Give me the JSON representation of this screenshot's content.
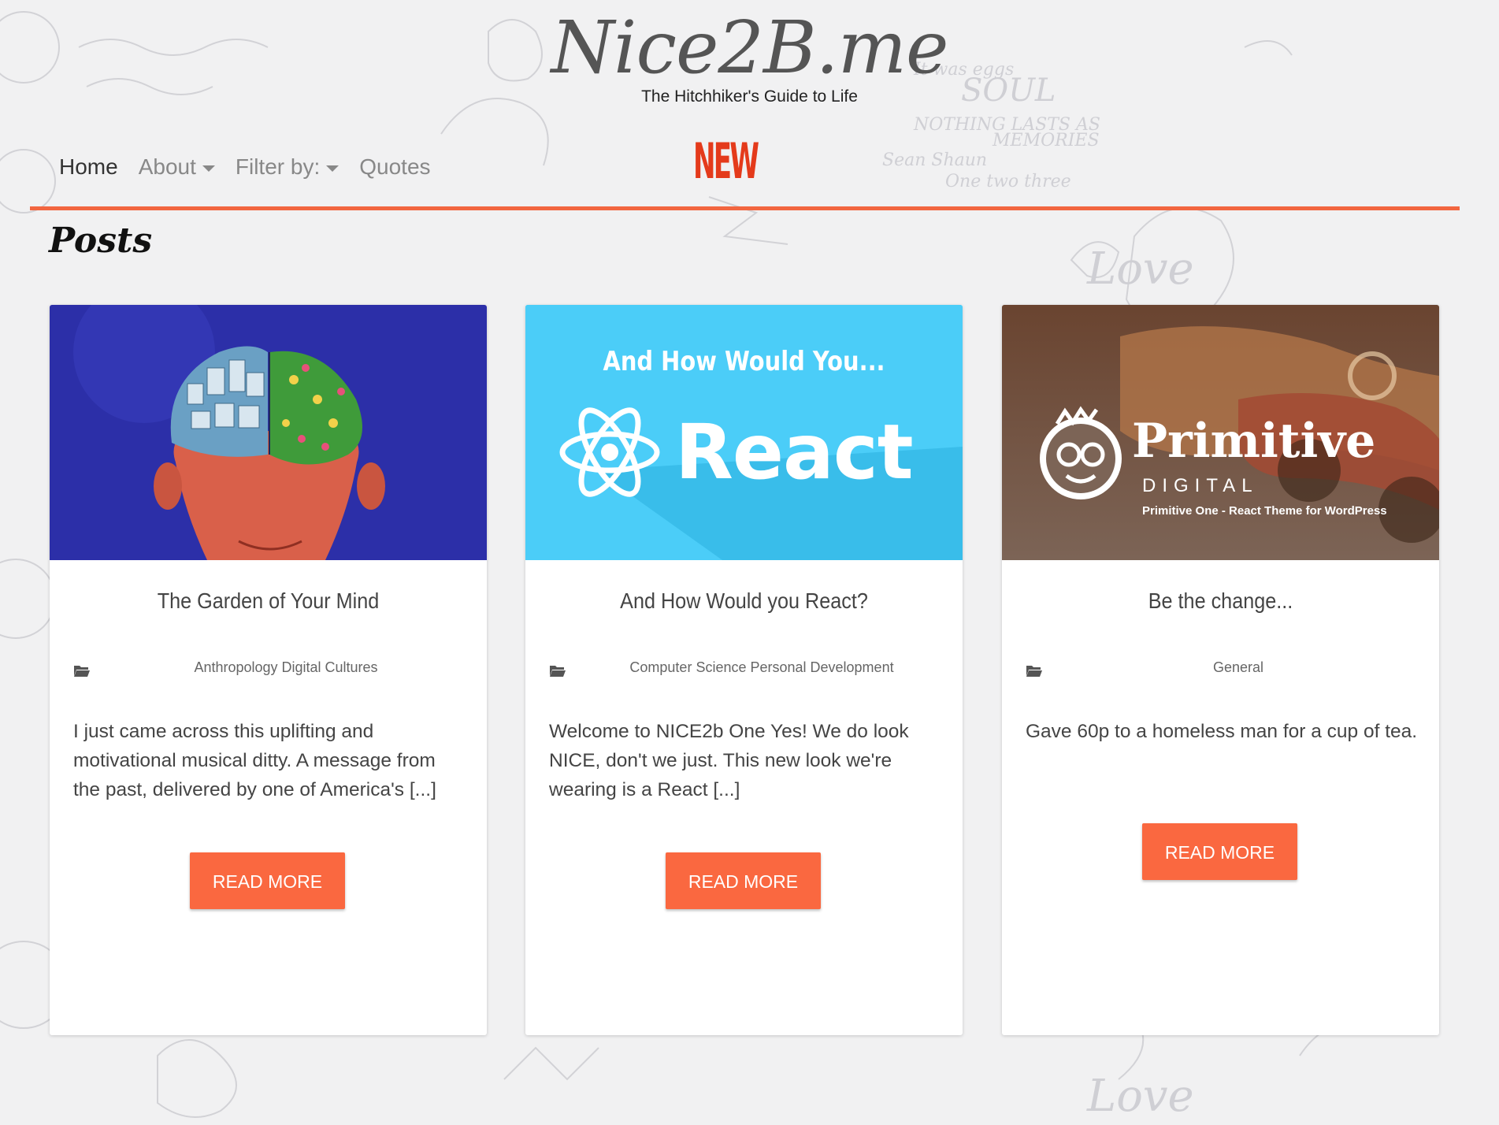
{
  "header": {
    "site_title": "Nice2B.me",
    "tagline": "The Hitchhiker's Guide to Life",
    "new_badge": "NEW"
  },
  "nav": {
    "items": [
      {
        "label": "Home",
        "active": true,
        "dropdown": false
      },
      {
        "label": "About",
        "active": false,
        "dropdown": true
      },
      {
        "label": "Filter by:",
        "active": false,
        "dropdown": true
      },
      {
        "label": "Quotes",
        "active": false,
        "dropdown": false
      }
    ]
  },
  "section": {
    "title": "Posts"
  },
  "posts": [
    {
      "title": "The Garden of Your Mind",
      "categories": "Anthropology Digital Cultures",
      "excerpt": "I just came across this uplifting and motivational musical ditty. A message from the past, delivered by one of America's [...]",
      "button": "READ MORE",
      "image_icon": "brain-garden-illustration"
    },
    {
      "title": "And How Would you React?",
      "categories": "Computer Science Personal Development",
      "excerpt": "Welcome to NICE2b One Yes! We do look NICE, don't we just. This new look we're wearing is a React [...]",
      "button": "READ MORE",
      "image_heading": "And How Would You...",
      "image_word": "React",
      "image_icon": "react-atom-icon"
    },
    {
      "title": "Be the change...",
      "categories": "General",
      "excerpt": "Gave 60p to a homeless man for a cup of tea.",
      "button": "READ MORE",
      "image_brand": "Primitive",
      "image_brand_sub": "DIGITAL",
      "image_caption": "Primitive One - React Theme for WordPress",
      "image_icon": "monkey-logo-icon"
    }
  ],
  "colors": {
    "accent": "#fa6840",
    "nav_rule": "#f26640",
    "new_badge": "#e43a1b",
    "background": "#f1f1f2",
    "react_blue": "#4bcdf8"
  }
}
